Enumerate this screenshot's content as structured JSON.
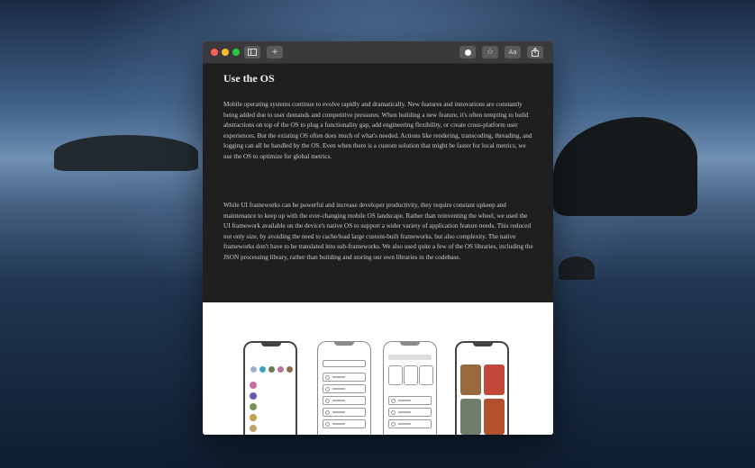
{
  "window": {
    "toolbar": {
      "traffic_lights": [
        "#ff5f57",
        "#febc2e",
        "#28c840"
      ],
      "sidebar_icon": "sidebar-icon",
      "new_tab_label": "+",
      "appearance_icon": "appearance-toggle-icon",
      "bookmark_label": "☆",
      "font_size_label": "Aa",
      "share_icon": "share-icon"
    },
    "article": {
      "heading": "Use the OS",
      "paragraph1": "Mobile operating systems continue to evolve rapidly and dramatically. New features and innovations are constantly being added due to user demands and competitive pressures. When building a new feature, it's often tempting to build abstractions on top of the OS to plug a functionality gap, add engineering flexibility, or create cross-platform user experiences. But the existing OS often does much of what's needed. Actions like rendering, transcoding, threading, and logging can all be handled by the OS. Even when there is a custom solution that might be faster for local metrics, we use the OS to optimize for global metrics.",
      "paragraph2": "While UI frameworks can be powerful and increase developer productivity, they require constant upkeep and maintenance to keep up with the ever-changing mobile OS landscape. Rather than reinventing the wheel, we used the UI framework available on the device's native OS to support a wider variety of application feature needs. This reduced not only size, by avoiding the need to cache/load large custom-built frameworks, but also complexity. The native frameworks don't have to be translated into sub-frameworks. We also used quite a few of the OS libraries, including the JSON processing library, rather than building and storing our own libraries in the codebase."
    }
  }
}
